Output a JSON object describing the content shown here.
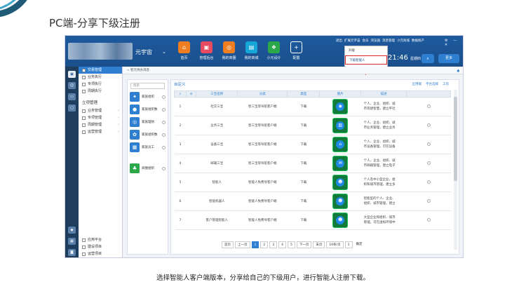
{
  "page_title": "PC端-分享下级注册",
  "caption": "选择智能人客户端版本，分享给自己的下级用户，进行智能人注册下载。",
  "app": {
    "brand": "元宇宙",
    "nav": [
      {
        "label": "首页",
        "icon": "home-icon",
        "color": "#f07d20",
        "glyph": "⌂"
      },
      {
        "label": "管理后台",
        "icon": "monitor-icon",
        "color": "#e84a5f",
        "glyph": "▣"
      },
      {
        "label": "我的商圈",
        "icon": "circle-icon",
        "color": "#f07d20",
        "glyph": "◎"
      },
      {
        "label": "我的商城",
        "icon": "cart-icon",
        "color": "#17a6d8",
        "glyph": "▤"
      },
      {
        "label": "小元设计",
        "icon": "design-icon",
        "color": "#2aa84a",
        "glyph": "❖"
      },
      {
        "label": "配置",
        "icon": "plus-icon",
        "color": "",
        "glyph": "+"
      }
    ],
    "top_links": [
      "退出",
      "扩展元宇宙",
      "会员",
      "浏览器",
      "消息管理",
      "小元商城",
      "数据统产"
    ],
    "window_controls": "⚙ — ✕",
    "dropdown": {
      "items": [
        "升级",
        "下级智能人"
      ],
      "highlight_index": 1
    },
    "clock": "21:46",
    "weekday": "星期四",
    "search_glyph": "⌕",
    "more_label": "更多"
  },
  "sidebar": {
    "top_items": [
      {
        "label": "交易管理",
        "active": true
      },
      {
        "label": "业务执行",
        "active": false
      },
      {
        "label": "专项执行",
        "active": false
      },
      {
        "label": "周期执行",
        "active": false
      }
    ],
    "section": "立项管理",
    "section_items": [
      {
        "label": "业务管理"
      },
      {
        "label": "专项管理"
      },
      {
        "label": "周期管理"
      },
      {
        "label": "运营管理"
      }
    ],
    "bottom_items": [
      {
        "label": "应用平台"
      },
      {
        "label": "建设项目"
      },
      {
        "label": "运营项目"
      }
    ]
  },
  "breadcrumb": "智元待办消息",
  "left_list": {
    "search_placeholder": "搜索",
    "items": [
      {
        "label": "家族组织",
        "glyph": "✦"
      },
      {
        "label": "家族组织数",
        "glyph": "●"
      },
      {
        "label": "家族理财",
        "glyph": "◎"
      },
      {
        "label": "家族组织数",
        "glyph": "✿"
      },
      {
        "label": "家族员工",
        "glyph": "▦"
      },
      {
        "label": "商圈组织",
        "glyph": "♣"
      }
    ]
  },
  "content": {
    "label": "自定义",
    "tools": [
      "应用端",
      "平台选择",
      "工作"
    ],
    "columns": [
      "",
      "",
      "三宝名称",
      "分类",
      "类型",
      "图片",
      "描述",
      ""
    ],
    "rows": [
      {
        "no": "1",
        "name": "社交三宝",
        "category": "智三宝等导航客户端",
        "type": "下载",
        "glyph": "◉",
        "desc1": "个人、企业、组织、城",
        "desc2": "市等建智慧，建立平社"
      },
      {
        "no": "2",
        "name": "业务三宝",
        "category": "智三宝等导航客户端",
        "type": "下载",
        "glyph": "▥",
        "desc1": "个人、企业、组织、城",
        "desc2": "市业务管理，建立业务"
      },
      {
        "no": "3",
        "name": "设备三宝",
        "category": "智三宝等导航客户端",
        "type": "下载",
        "glyph": "⌂",
        "desc1": "个人、企业、组织、城",
        "desc2": "市设备管理，可在设备"
      },
      {
        "no": "4",
        "name": "邮箱三宝",
        "category": "智三宝等导航客户端",
        "type": "下载",
        "glyph": "✉",
        "desc1": "个人、企业、组织、城",
        "desc2": "市邮箱管理，建立电子"
      },
      {
        "no": "5",
        "name": "智能人",
        "category": "智能人免费导客户端",
        "type": "下载",
        "glyph": "☻",
        "desc1": "个人及中小型企业、组",
        "desc2": "织和城市管理，建立多"
      },
      {
        "no": "6",
        "name": "智能机器人",
        "category": "智能人免费导客户端",
        "type": "下载",
        "glyph": "☻",
        "desc1": "智能型的个人、企业、",
        "desc2": "组织、城市管理，建立"
      },
      {
        "no": "7",
        "name": "客户管理智能人",
        "category": "智能人免费导客户端",
        "type": "下载",
        "glyph": "☻",
        "desc1": "大型企业和组织、城市",
        "desc2": "管理，可在虚拟环境中"
      }
    ],
    "pager": {
      "first": "首页",
      "prev": "上一页",
      "pages": [
        "1",
        "2",
        "3",
        "4",
        "5"
      ],
      "current": "1",
      "next": "下一页",
      "last": "末页",
      "page_size": "10条/页",
      "goto_value": "1",
      "confirm": "确定"
    }
  }
}
